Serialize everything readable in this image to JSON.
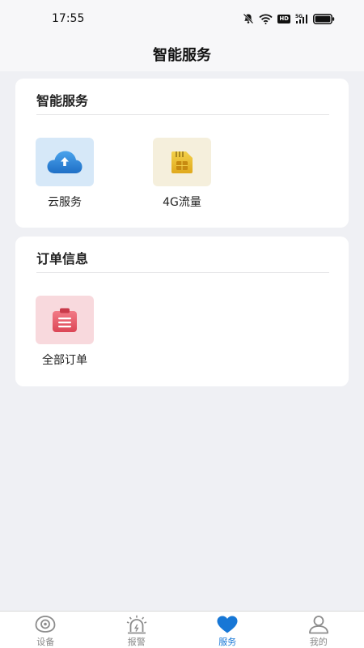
{
  "status_bar": {
    "time": "17:55",
    "icons": [
      "bell-off-icon",
      "wifi-icon",
      "hd-icon",
      "signal-5g-icon",
      "battery-icon"
    ],
    "hd_label": "HD"
  },
  "header": {
    "title": "智能服务"
  },
  "sections": [
    {
      "title": "智能服务",
      "items": [
        {
          "label": "云服务",
          "icon": "cloud-upload-icon",
          "bg": "#d6e8f8"
        },
        {
          "label": "4G流量",
          "icon": "sim-card-icon",
          "bg": "#f5efdc"
        }
      ]
    },
    {
      "title": "订单信息",
      "items": [
        {
          "label": "全部订单",
          "icon": "order-clipboard-icon",
          "bg": "#f8d9dd"
        }
      ]
    }
  ],
  "bottom_nav": {
    "tabs": [
      {
        "label": "设备",
        "icon": "device-eye-icon"
      },
      {
        "label": "报警",
        "icon": "alarm-siren-icon"
      },
      {
        "label": "服务",
        "icon": "heart-icon",
        "active": true
      },
      {
        "label": "我的",
        "icon": "person-icon"
      }
    ]
  },
  "colors": {
    "accent": "#1777d6",
    "background": "#eff0f4",
    "card": "#ffffff",
    "inactive_tab": "#888888"
  }
}
